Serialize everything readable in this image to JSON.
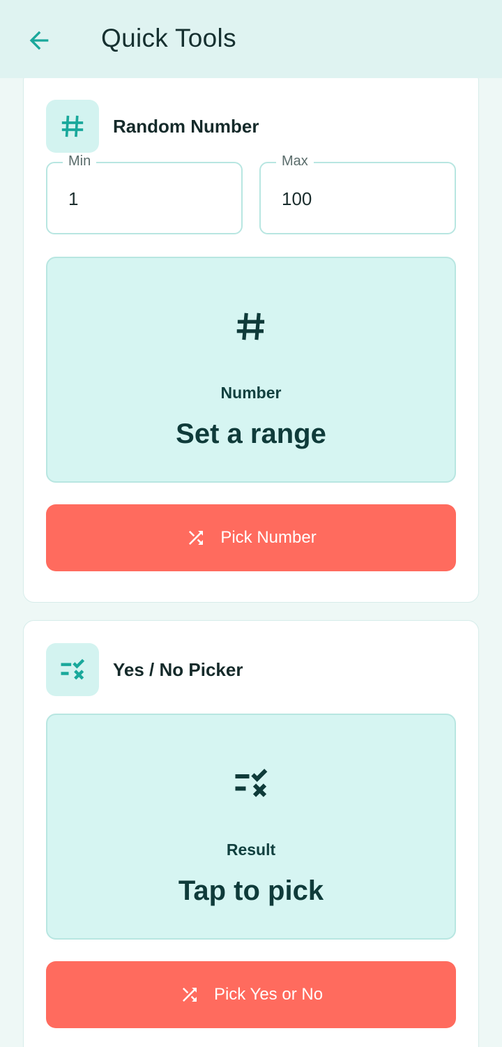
{
  "app_bar": {
    "title": "Quick Tools",
    "back_icon": "arrow-back-icon"
  },
  "random_number": {
    "title": "Random Number",
    "icon": "hash-icon",
    "min": {
      "label": "Min",
      "value": "1"
    },
    "max": {
      "label": "Max",
      "value": "100"
    },
    "result": {
      "icon": "hash-icon",
      "label": "Number",
      "value": "Set a range"
    },
    "button": {
      "icon": "shuffle-icon",
      "label": "Pick Number"
    }
  },
  "yes_no": {
    "title": "Yes / No Picker",
    "icon": "rule-check-icon",
    "result": {
      "icon": "rule-check-icon",
      "label": "Result",
      "value": "Tap to pick"
    },
    "button": {
      "icon": "shuffle-icon",
      "label": "Pick Yes or No"
    }
  },
  "colors": {
    "accent": "#19a89b",
    "app_bar_bg": "#dff3f1",
    "result_bg": "#d6f5f2",
    "button_bg": "#ff6b5e",
    "dark_text": "#0f3b3a"
  }
}
